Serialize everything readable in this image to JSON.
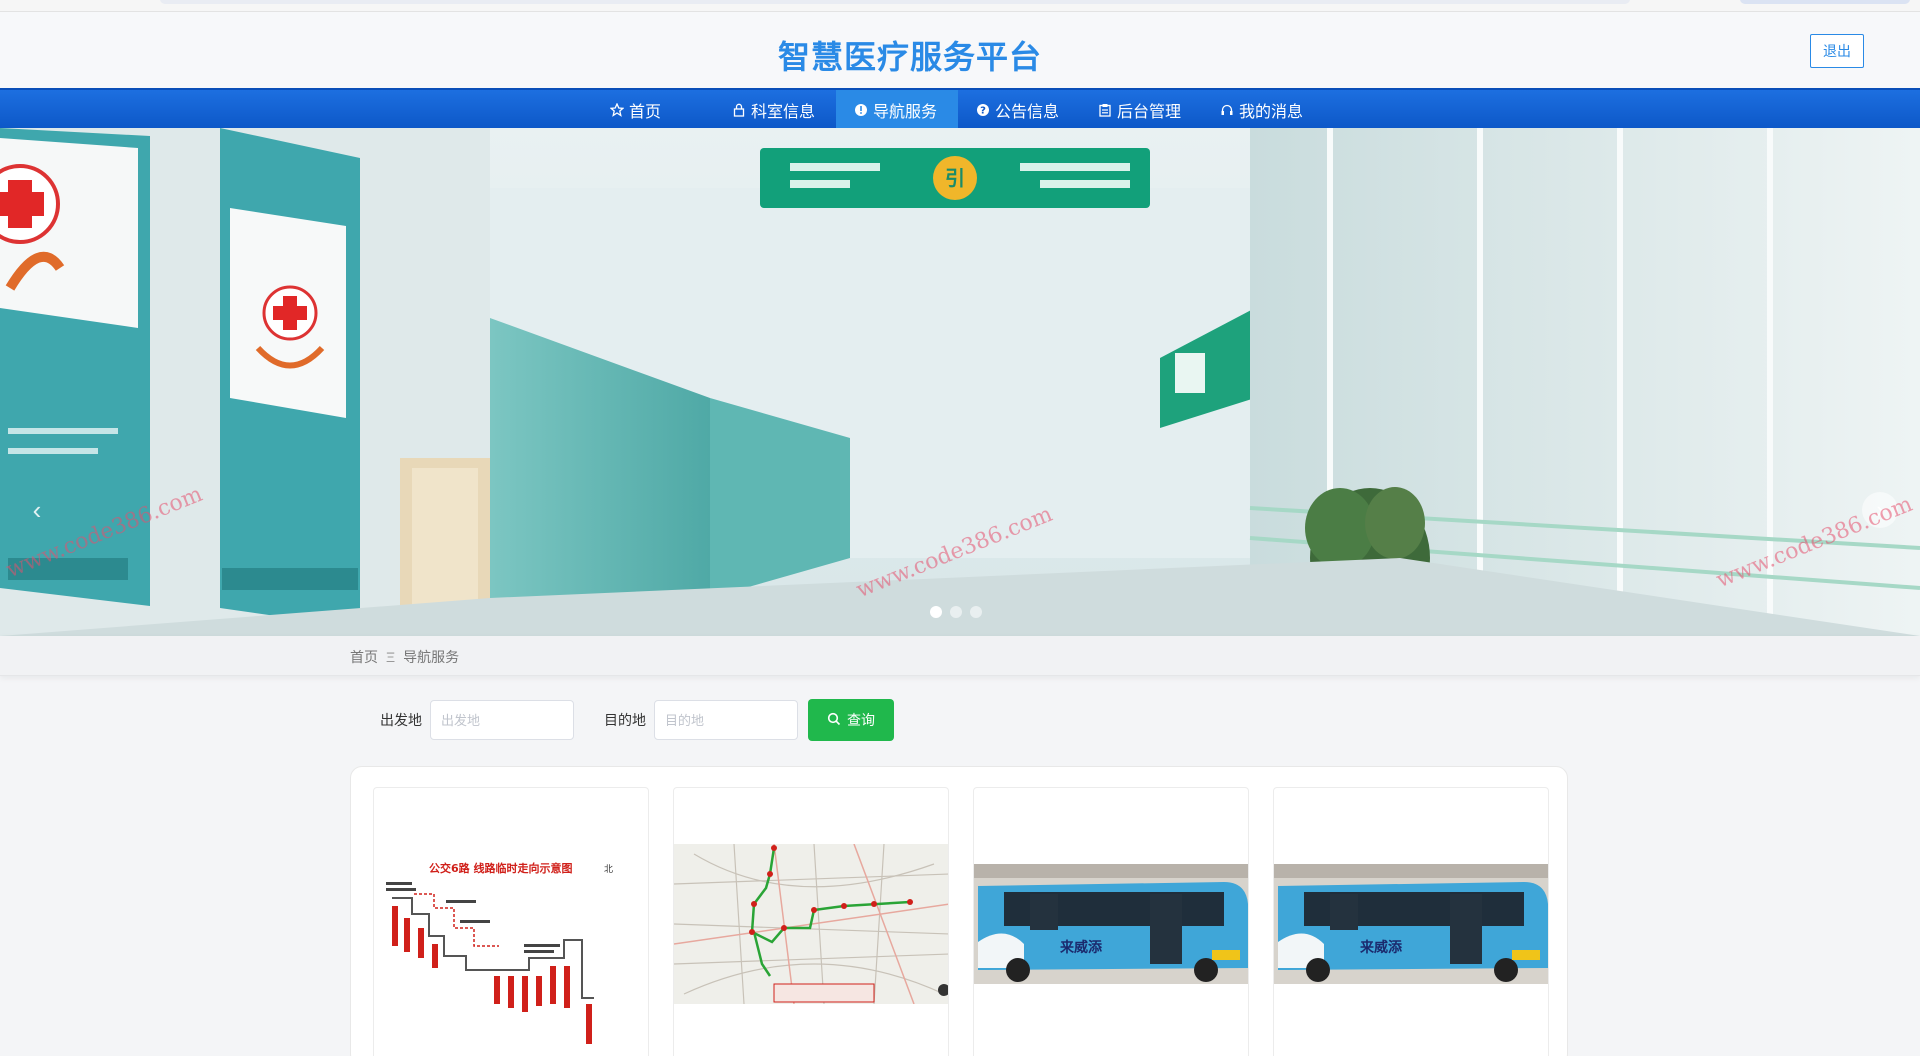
{
  "header": {
    "title": "智慧医疗服务平台",
    "logout_label": "退出"
  },
  "nav": {
    "items": [
      {
        "icon": "star-icon",
        "label": "首页"
      },
      {
        "icon": "lock-icon",
        "label": "科室信息"
      },
      {
        "icon": "info-circle-icon",
        "label": "导航服务",
        "active": true
      },
      {
        "icon": "question-circle-icon",
        "label": "公告信息"
      },
      {
        "icon": "clipboard-icon",
        "label": "后台管理"
      },
      {
        "icon": "headset-icon",
        "label": "我的消息"
      }
    ]
  },
  "banner": {
    "slide_count": 3,
    "active_slide": 1,
    "watermark": "www.code386.com",
    "sign_text": "引"
  },
  "breadcrumb": {
    "home": "首页",
    "separator": "Ξ",
    "current": "导航服务"
  },
  "search": {
    "origin_label": "出发地",
    "origin_placeholder": "出发地",
    "origin_value": "",
    "destination_label": "目的地",
    "destination_placeholder": "目的地",
    "destination_value": "",
    "button_label": "查询"
  },
  "cards": [
    {
      "title": "公交6路 线路临时走向示意图",
      "north_label": "北",
      "kind": "route-diagram"
    },
    {
      "kind": "route-map"
    },
    {
      "bus_text": "来威添",
      "kind": "bus-photo"
    },
    {
      "bus_text": "来威添",
      "kind": "bus-photo"
    }
  ],
  "colors": {
    "accent": "#2a8ae6",
    "nav": "#0d58c8",
    "button": "#20b84c"
  }
}
